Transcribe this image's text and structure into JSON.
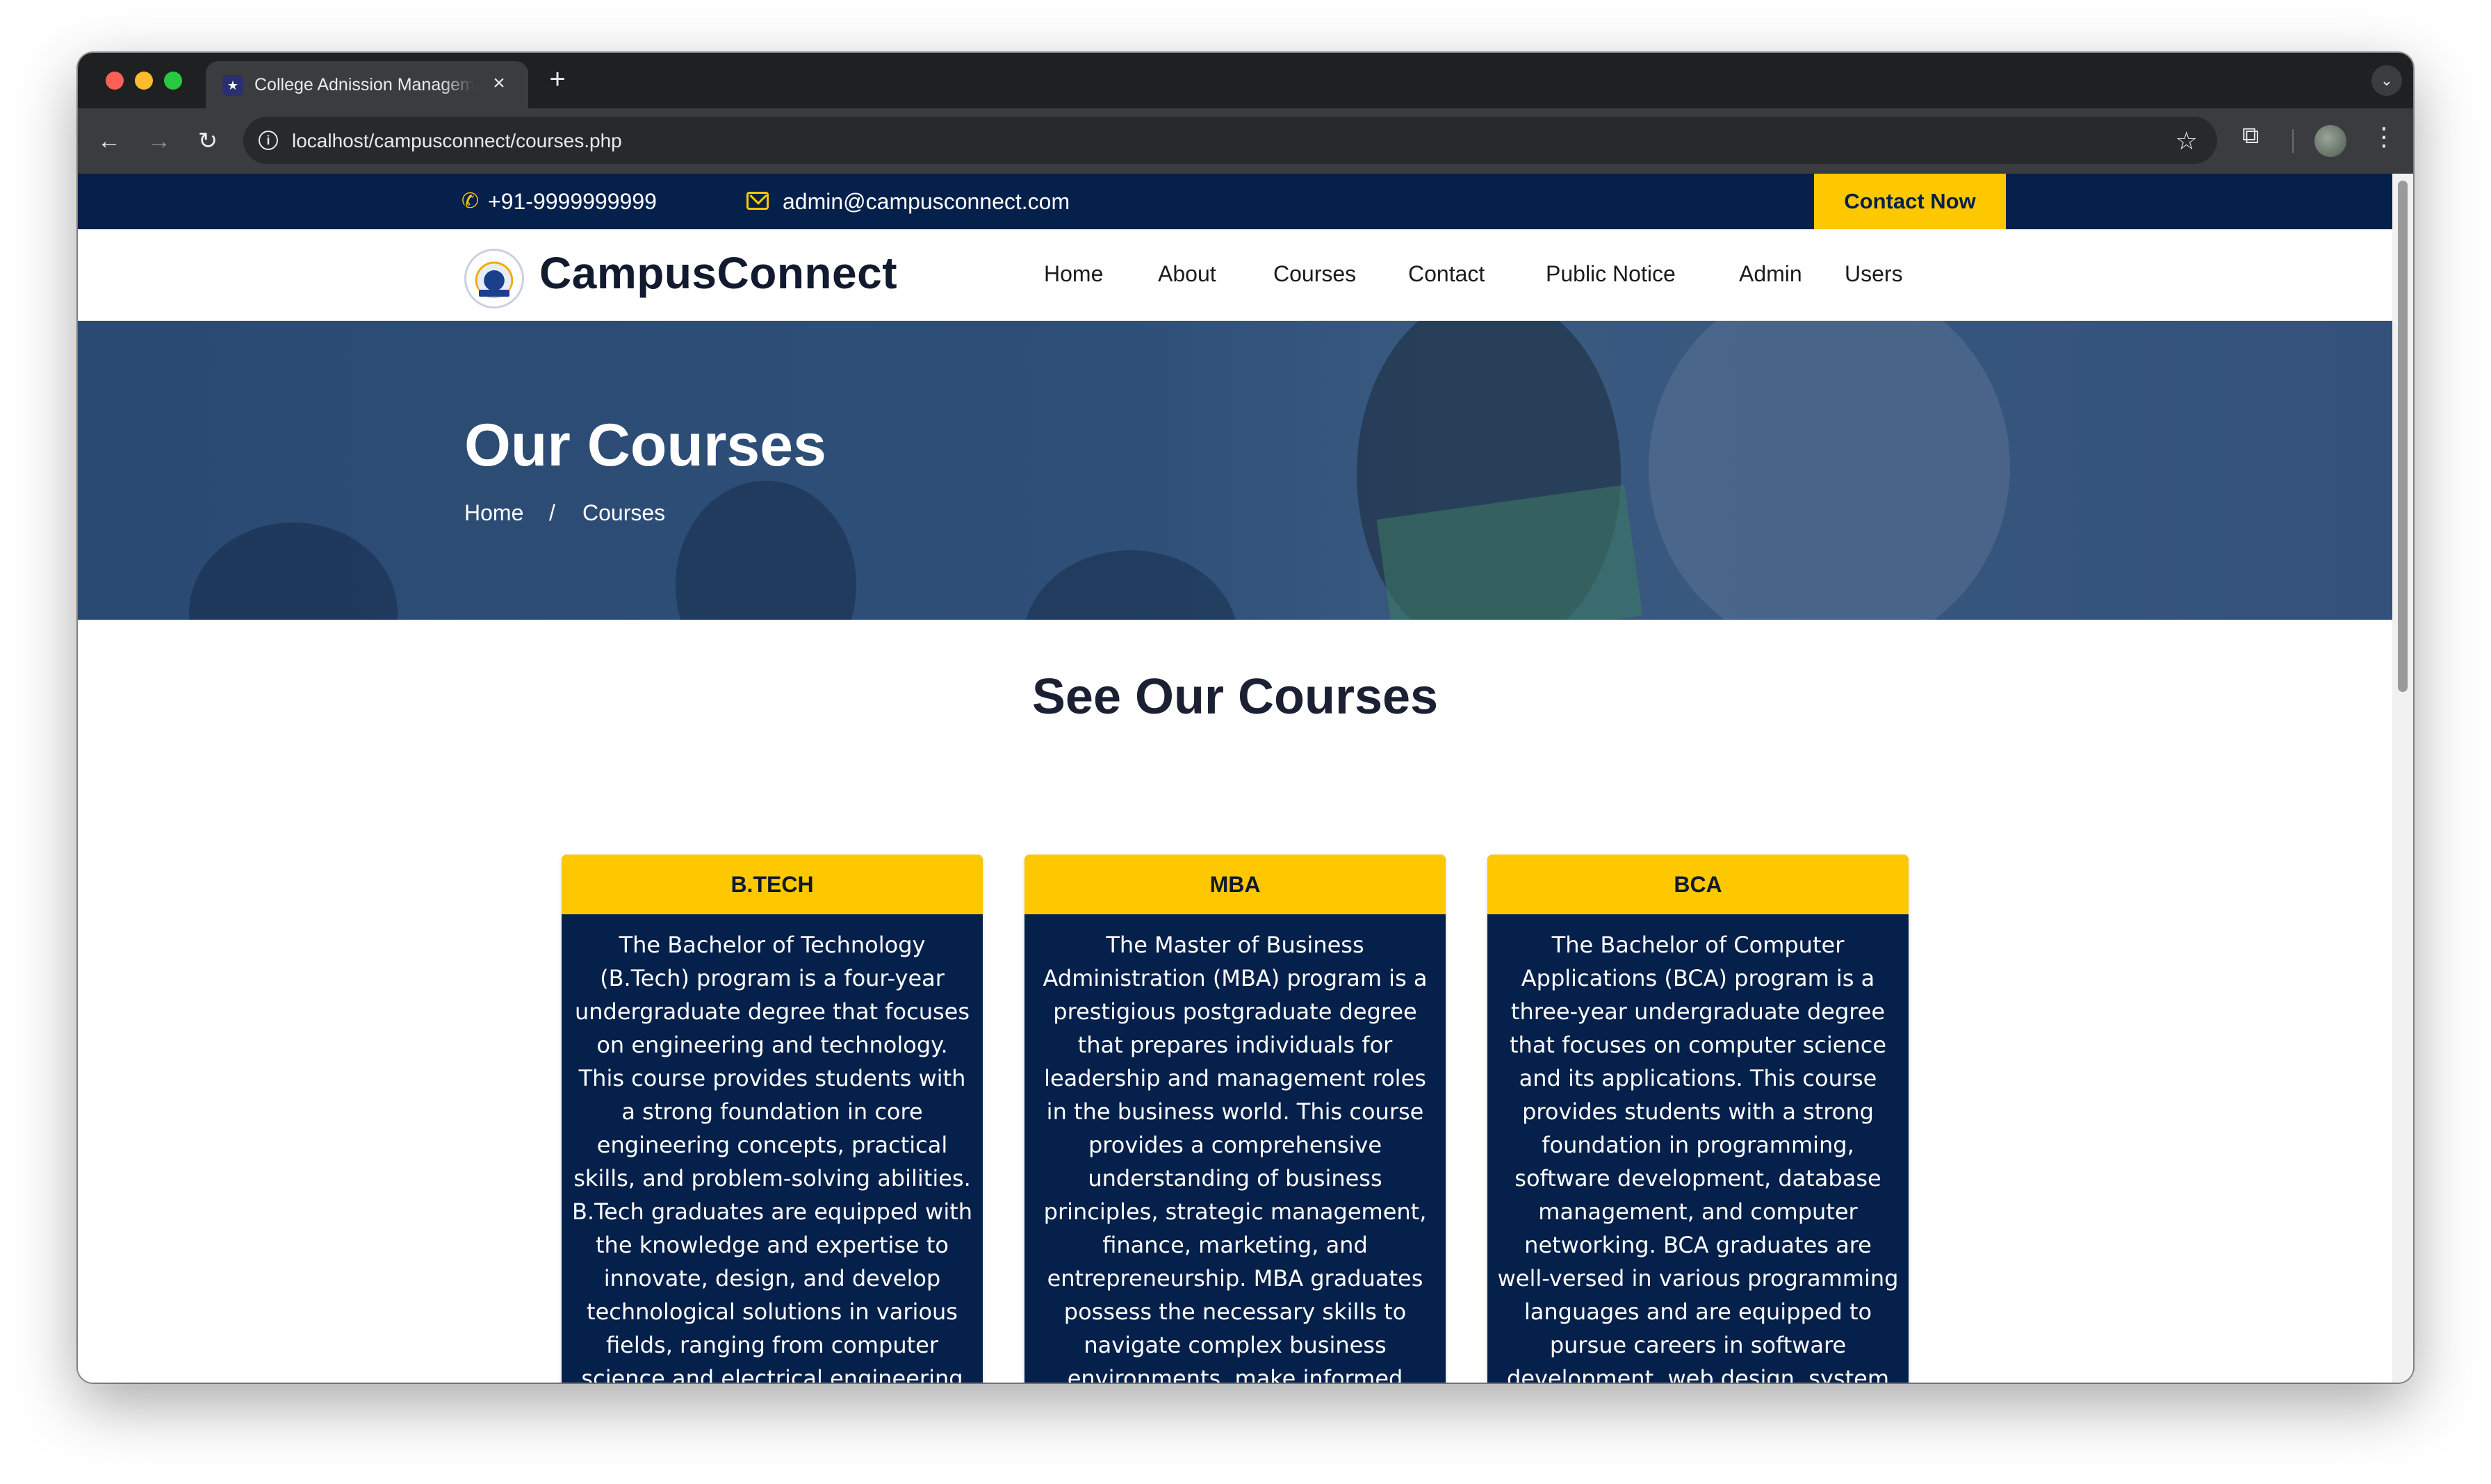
{
  "browser": {
    "tab_title": "College Adnission Management",
    "url": "localhost/campusconnect/courses.php",
    "new_tab": "+",
    "close": "×"
  },
  "topbar": {
    "phone": "+91-9999999999",
    "email": "admin@campusconnect.com",
    "cta": "Contact Now"
  },
  "nav": {
    "brand": "CampusConnect",
    "items": [
      "Home",
      "About",
      "Courses",
      "Contact",
      "Public Notice",
      "Admin",
      "Users"
    ]
  },
  "hero": {
    "title": "Our Courses",
    "breadcrumb": [
      "Home",
      "/",
      "Courses"
    ]
  },
  "section": {
    "title": "See Our Courses"
  },
  "courses": [
    {
      "name": "B.TECH",
      "description": "The Bachelor of Technology (B.Tech) program is a four-year undergraduate degree that focuses on engineering and technology. This course provides students with a strong foundation in core engineering concepts, practical skills, and problem-solving abilities. B.Tech graduates are equipped with the knowledge and expertise to innovate, design, and develop technological solutions in various fields, ranging from computer science and electrical engineering"
    },
    {
      "name": "MBA",
      "description": "The Master of Business Administration (MBA) program is a prestigious postgraduate degree that prepares individuals for leadership and management roles in the business world. This course provides a comprehensive understanding of business principles, strategic management, finance, marketing, and entrepreneurship. MBA graduates possess the necessary skills to navigate complex business environments, make informed"
    },
    {
      "name": "BCA",
      "description": "The Bachelor of Computer Applications (BCA) program is a three-year undergraduate degree that focuses on computer science and its applications. This course provides students with a strong foundation in programming, software development, database management, and computer networking. BCA graduates are well-versed in various programming languages and are equipped to pursue careers in software development, web design, system"
    }
  ],
  "colors": {
    "navy": "#05204a",
    "accent": "#fdc800"
  }
}
